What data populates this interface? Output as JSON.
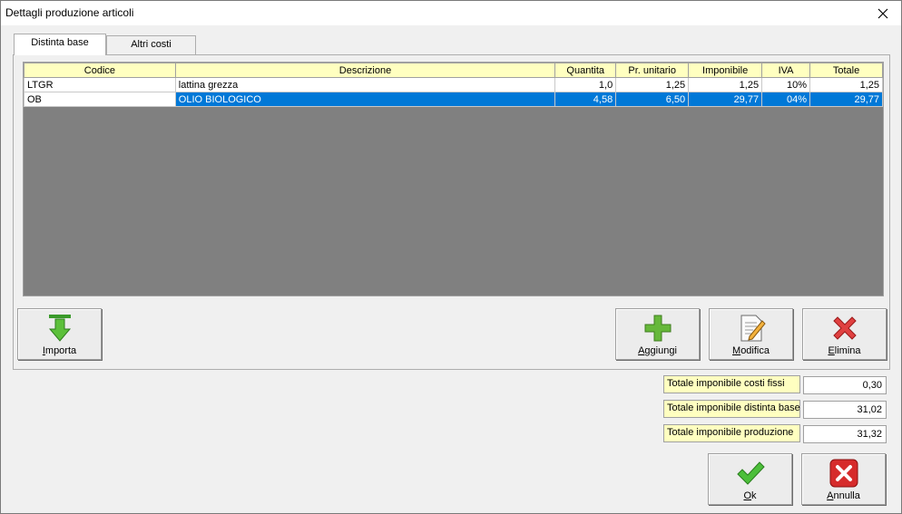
{
  "window": {
    "title": "Dettagli produzione articoli",
    "close_symbol": "✕"
  },
  "tabs": [
    {
      "label": "Distinta base",
      "active": true
    },
    {
      "label": "Altri costi",
      "active": false
    }
  ],
  "grid": {
    "columns": [
      "Codice",
      "Descrizione",
      "Quantita",
      "Pr. unitario",
      "Imponibile",
      "IVA",
      "Totale"
    ],
    "rows": [
      {
        "codice": "LTGR",
        "descrizione": "lattina grezza",
        "quantita": "1,0",
        "prezzo": "1,25",
        "imponibile": "1,25",
        "iva": "10%",
        "totale": "1,25",
        "selected": false
      },
      {
        "codice": "OB",
        "descrizione": "OLIO BIOLOGICO",
        "quantita": "4,58",
        "prezzo": "6,50",
        "imponibile": "29,77",
        "iva": "04%",
        "totale": "29,77",
        "selected": true
      }
    ],
    "header_color": "#ffffc0",
    "selection_color": "#0078d7",
    "empty_area_color": "#808080"
  },
  "buttons": {
    "importa": {
      "label_u": "I",
      "label_rest": "mporta",
      "icon": "arrow-down-icon"
    },
    "aggiungi": {
      "label_u": "A",
      "label_rest": "ggiungi",
      "icon": "plus-icon"
    },
    "modifica": {
      "label_u": "M",
      "label_rest": "odifica",
      "icon": "edit-document-icon"
    },
    "elimina": {
      "label_u": "E",
      "label_rest": "limina",
      "icon": "delete-x-icon"
    },
    "ok": {
      "label_u": "O",
      "label_rest": "k",
      "icon": "check-icon"
    },
    "annulla": {
      "label_u": "A",
      "label_rest": "nnulla",
      "icon": "cancel-icon"
    }
  },
  "totals": [
    {
      "label": "Totale imponibile costi fissi",
      "value": "0,30"
    },
    {
      "label": "Totale imponibile distinta base",
      "value": "31,02"
    },
    {
      "label": "Totale imponibile produzione",
      "value": "31,32"
    }
  ]
}
